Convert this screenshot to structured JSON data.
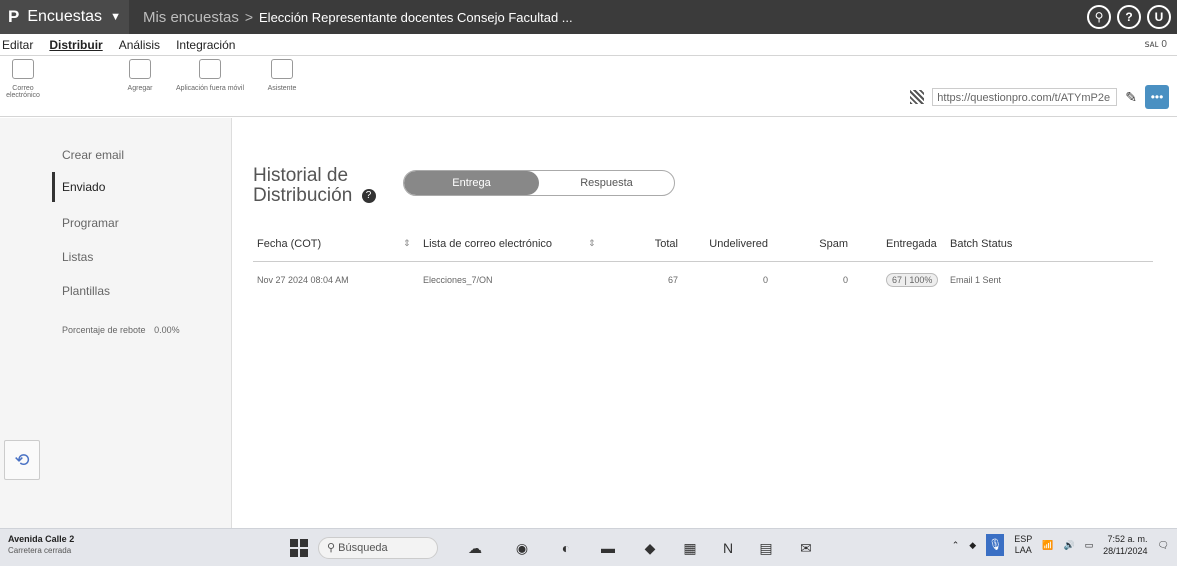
{
  "header": {
    "logo": "P",
    "app_name": "Encuestas",
    "breadcrumb_root": "Mis encuestas",
    "breadcrumb_sep": ">",
    "breadcrumb_current": "Elección Representante docentes Consejo Facultad ..."
  },
  "tabs": {
    "editar": "Editar",
    "distribuir": "Distribuir",
    "analisis": "Análisis",
    "integracion": "Integración",
    "right_indicator": "ꜱᴀʟ 0"
  },
  "toolbar": {
    "tool1": "Correo electrónico",
    "tool2": "Agregar",
    "tool3": "Aplicación fuera móvil",
    "tool4": "Asistente",
    "share_url": "https://questionpro.com/t/ATYmP2e"
  },
  "sidebar": {
    "crear_email": "Crear email",
    "enviado": "Enviado",
    "programar": "Programar",
    "listas": "Listas",
    "plantillas": "Plantillas",
    "metric_label": "Porcentaje de rebote",
    "metric_value": "0.00%"
  },
  "main": {
    "title": "Historial de Distribución",
    "help_glyph": "?",
    "tab_entrega": "Entrega",
    "tab_respuesta": "Respuesta",
    "columns": {
      "fecha": "Fecha (COT)",
      "lista": "Lista de correo electrónico",
      "total": "Total",
      "undelivered": "Undelivered",
      "spam": "Spam",
      "entregada": "Entregada",
      "batch": "Batch Status"
    },
    "rows": [
      {
        "fecha": "Nov 27 2024 08:04 AM",
        "lista": "Elecciones_7/ON",
        "total": "67",
        "undelivered": "0",
        "spam": "0",
        "entregada": "67 | 100%",
        "batch": "Email 1 Sent"
      }
    ]
  },
  "taskbar": {
    "weather_title": "Avenida Calle 2",
    "weather_sub": "Carretera cerrada",
    "search": "Búsqueda",
    "lang_top": "ESP",
    "lang_bottom": "LAA",
    "time": "7:52 a. m.",
    "date": "28/11/2024"
  }
}
